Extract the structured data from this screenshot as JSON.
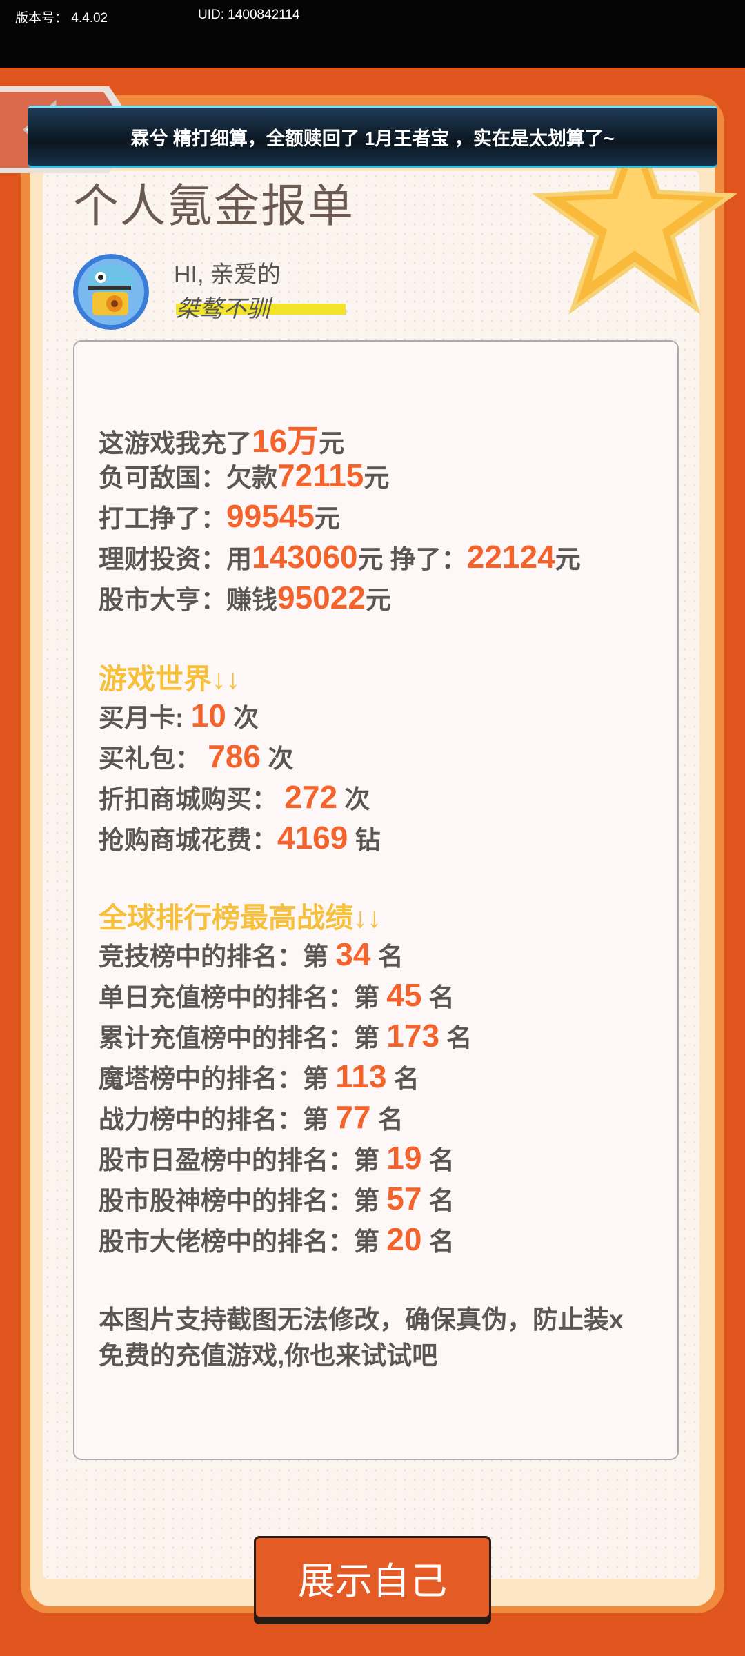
{
  "status": {
    "version_text": "版本号： 4.4.02",
    "uid_text": "UID: 1400842114"
  },
  "banner": {
    "text": "霖兮 精打细算，全额赎回了 1月王者宝 ，实在是太划算了~"
  },
  "report": {
    "title": "个人氪金报单",
    "greeting": "HI, 亲爱的",
    "nickname": "桀骜不驯"
  },
  "summary": {
    "recharge_prefix": "这游戏我充了",
    "recharge_value": "16万",
    "recharge_unit": "元",
    "debt_prefix": "负可敌国：欠款",
    "debt_value": "72115",
    "debt_unit": "元",
    "work_prefix": "打工挣了：",
    "work_value": "99545",
    "work_unit": "元",
    "invest_prefix": "理财投资：用",
    "invest_used": "143060",
    "invest_mid": "元 挣了：",
    "invest_earned": "22124",
    "invest_unit": "元",
    "stock_prefix": "股市大亨：赚钱",
    "stock_value": "95022",
    "stock_unit": "元"
  },
  "game_world": {
    "heading": "游戏世界↓↓",
    "monthly_prefix": "买月卡:",
    "monthly_value": "10",
    "monthly_unit": "次",
    "gift_prefix": "买礼包：",
    "gift_value": "786",
    "gift_unit": "次",
    "discount_prefix": "折扣商城购买：",
    "discount_value": "272",
    "discount_unit": "次",
    "flash_prefix": "抢购商城花费：",
    "flash_value": "4169",
    "flash_unit": "钻"
  },
  "ranking": {
    "heading": "全球排行榜最高战绩↓↓",
    "rows": [
      {
        "prefix": "竞技榜中的排名：第",
        "value": "34",
        "suffix": "名"
      },
      {
        "prefix": "单日充值榜中的排名：第",
        "value": "45",
        "suffix": "名"
      },
      {
        "prefix": "累计充值榜中的排名：第",
        "value": "173",
        "suffix": "名"
      },
      {
        "prefix": "魔塔榜中的排名：第",
        "value": "113",
        "suffix": "名"
      },
      {
        "prefix": "战力榜中的排名：第",
        "value": "77",
        "suffix": "名"
      },
      {
        "prefix": "股市日盈榜中的排名：第",
        "value": "19",
        "suffix": "名"
      },
      {
        "prefix": "股市股神榜中的排名：第",
        "value": "57",
        "suffix": "名"
      },
      {
        "prefix": "股市大佬榜中的排名：第",
        "value": "20",
        "suffix": "名"
      }
    ]
  },
  "footer_note": {
    "line1": "本图片支持截图无法修改，确保真伪，防止装x",
    "line2": "免费的充值游戏,你也来试试吧"
  },
  "show_button": {
    "label": "展示自己"
  },
  "colors": {
    "accent": "#f3632b",
    "section": "#f7c03a",
    "frame": "#e0541d",
    "banner": "#0b1620"
  }
}
